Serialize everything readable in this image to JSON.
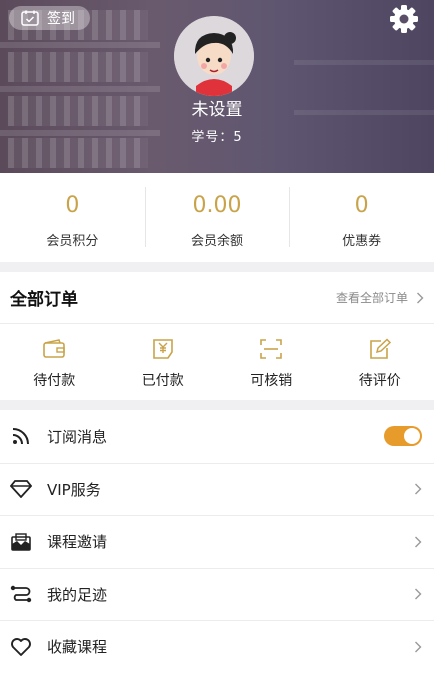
{
  "header": {
    "signin_label": "签到",
    "nickname": "未设置",
    "student_no": "学号：5"
  },
  "stats": [
    {
      "value": "0",
      "label": "会员积分"
    },
    {
      "value": "0.00",
      "label": "会员余额"
    },
    {
      "value": "0",
      "label": "优惠券"
    }
  ],
  "orders": {
    "title": "全部订单",
    "view_all": "查看全部订单",
    "items": [
      {
        "label": "待付款",
        "icon": "wallet-icon"
      },
      {
        "label": "已付款",
        "icon": "paid-receipt-icon"
      },
      {
        "label": "可核销",
        "icon": "scan-icon"
      },
      {
        "label": "待评价",
        "icon": "edit-review-icon"
      }
    ]
  },
  "menu": [
    {
      "label": "订阅消息",
      "icon": "rss-icon",
      "toggle_on": true
    },
    {
      "label": "VIP服务",
      "icon": "diamond-icon"
    },
    {
      "label": "课程邀请",
      "icon": "invitation-icon"
    },
    {
      "label": "我的足迹",
      "icon": "route-icon"
    },
    {
      "label": "收藏课程",
      "icon": "heart-icon"
    }
  ],
  "colors": {
    "accent_gold": "#c9a34a",
    "toggle_orange": "#e79b2a"
  }
}
